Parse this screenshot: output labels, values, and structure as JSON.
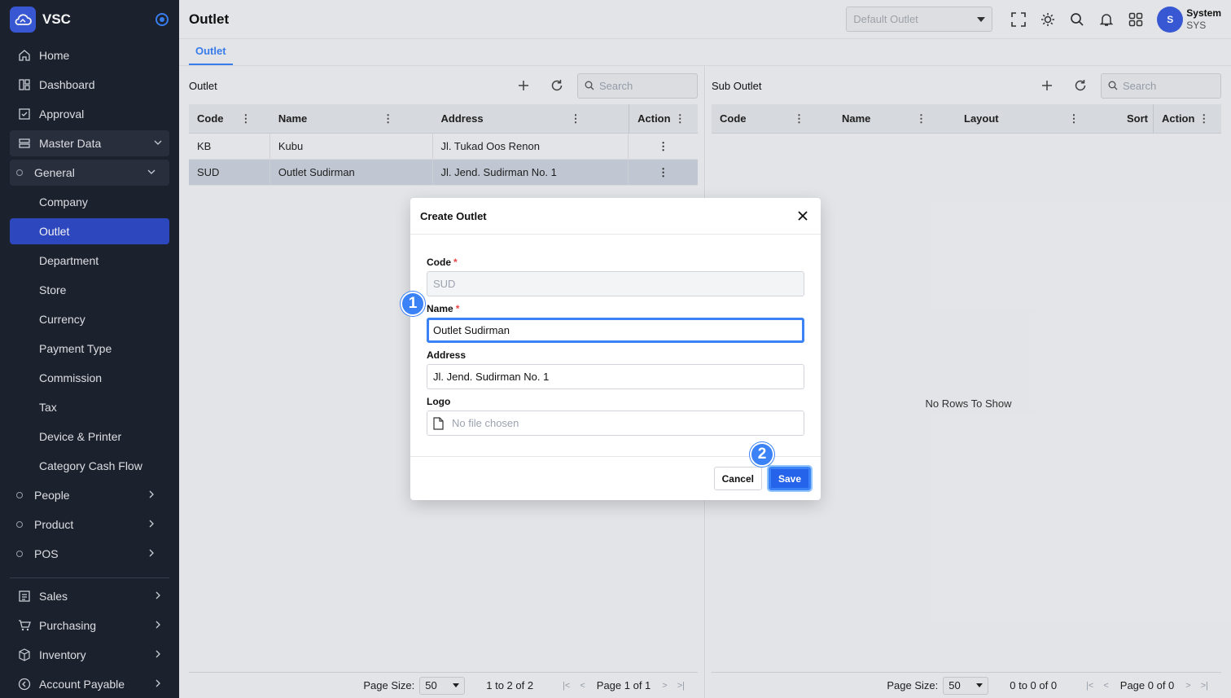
{
  "brand": {
    "name": "VSC"
  },
  "sidebar": {
    "items": [
      {
        "label": "Home",
        "icon": "home-icon"
      },
      {
        "label": "Dashboard",
        "icon": "dashboard-icon"
      },
      {
        "label": "Approval",
        "icon": "approval-icon"
      },
      {
        "label": "Master Data",
        "icon": "database-icon"
      },
      {
        "label": "General"
      },
      {
        "label": "Company"
      },
      {
        "label": "Outlet"
      },
      {
        "label": "Department"
      },
      {
        "label": "Store"
      },
      {
        "label": "Currency"
      },
      {
        "label": "Payment Type"
      },
      {
        "label": "Commission"
      },
      {
        "label": "Tax"
      },
      {
        "label": "Device & Printer"
      },
      {
        "label": "Category Cash Flow"
      },
      {
        "label": "People"
      },
      {
        "label": "Product"
      },
      {
        "label": "POS"
      },
      {
        "label": "Sales",
        "icon": "sales-icon"
      },
      {
        "label": "Purchasing",
        "icon": "cart-icon"
      },
      {
        "label": "Inventory",
        "icon": "box-icon"
      },
      {
        "label": "Account Payable",
        "icon": "payable-icon"
      }
    ]
  },
  "header": {
    "title": "Outlet",
    "outlet_select": "Default Outlet",
    "user": {
      "initial": "S",
      "name": "System",
      "code": "SYS"
    }
  },
  "tabs": [
    {
      "label": "Outlet"
    }
  ],
  "left_panel": {
    "title": "Outlet",
    "search_placeholder": "Search",
    "columns": [
      "Code",
      "Name",
      "Address",
      "Action"
    ],
    "rows": [
      {
        "code": "KB",
        "name": "Kubu",
        "address": "Jl. Tukad Oos Renon"
      },
      {
        "code": "SUD",
        "name": "Outlet Sudirman",
        "address": "Jl. Jend. Sudirman No. 1"
      }
    ],
    "pager": {
      "page_size_label": "Page Size:",
      "page_size": "50",
      "count": "1 to 2 of 2",
      "page": "Page 1 of 1"
    }
  },
  "right_panel": {
    "title": "Sub Outlet",
    "search_placeholder": "Search",
    "columns": [
      "Code",
      "Name",
      "Layout",
      "Sort",
      "Action"
    ],
    "empty_text": "No Rows To Show",
    "pager": {
      "page_size_label": "Page Size:",
      "page_size": "50",
      "count": "0 to 0 of 0",
      "page": "Page 0 of 0"
    }
  },
  "modal": {
    "title": "Create Outlet",
    "fields": {
      "code": {
        "label": "Code",
        "value": "SUD"
      },
      "name": {
        "label": "Name",
        "value": "Outlet Sudirman"
      },
      "address": {
        "label": "Address",
        "value": "Jl. Jend. Sudirman No. 1"
      },
      "logo": {
        "label": "Logo",
        "value": "No file chosen"
      }
    },
    "required_mark": "*",
    "cancel_label": "Cancel",
    "save_label": "Save"
  },
  "markers": [
    "1",
    "2"
  ],
  "colors": {
    "accent": "#3b82f6",
    "sidebar_bg": "#1e2330",
    "active": "#2f4ac7"
  }
}
